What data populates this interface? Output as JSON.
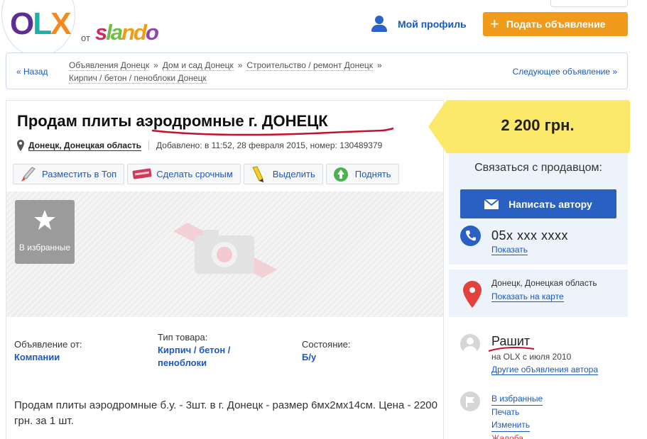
{
  "header": {
    "logo_main": "OLX",
    "logo_from": "от",
    "logo_brand": "slando",
    "profile_label": "Мой профиль",
    "post_ad_label": "Подать объявление",
    "post_ad_icon": "plus-icon",
    "accent_color": "#f09b1b"
  },
  "breadcrumb": {
    "back_label": "« Назад",
    "items": [
      "Объявления Донецк",
      "Дом и сад Донецк",
      "Строительство / ремонт Донецк",
      "Кирпич / бетон / пеноблоки Донецк"
    ],
    "separator": "»",
    "next_label": "Следующее объявление »"
  },
  "ad": {
    "title": "Продам плиты аэродромные г. ДОНЕЦК",
    "location": "Донецк, Донецкая область",
    "added": "Добавлено: в 11:52, 28 февраля 2015, номер: 130489379",
    "actions": [
      {
        "label": "Разместить в Топ",
        "icon": "rocket-icon"
      },
      {
        "label": "Сделать срочным",
        "icon": "urgent-tag-icon"
      },
      {
        "label": "Выделить",
        "icon": "highlighter-icon"
      },
      {
        "label": "Поднять",
        "icon": "lift-up-icon"
      }
    ],
    "favorite_label": "В избранные",
    "params": [
      {
        "key": "Объявление от:",
        "value": "Компании"
      },
      {
        "key": "Тип товара:",
        "value": "Кирпич / бетон / пеноблоки"
      },
      {
        "key": "Состояние:",
        "value": "Б/у"
      }
    ],
    "description": "Продам плиты аэродромные б.у. - 3шт. в г. Донецк - размер 6мх2мх14см. Цена - 2200 грн. за 1 шт."
  },
  "sidebar": {
    "price": "2 200 грн.",
    "contact_title": "Связаться с продавцом:",
    "write_label": "Написать автору",
    "phone": "05x xxx xxxx",
    "phone_show": "Показать",
    "location": "Донецк, Донецкая область",
    "show_on_map": "Показать на карте",
    "seller_name": "Рашит",
    "seller_since": "на OLX с июля 2010",
    "seller_other": "Другие объявления автора",
    "links": [
      "В избранные",
      "Печать",
      "Изменить",
      "Жалоба"
    ],
    "price_bg_color": "#fce96a",
    "button_color": "#2a60c1"
  }
}
